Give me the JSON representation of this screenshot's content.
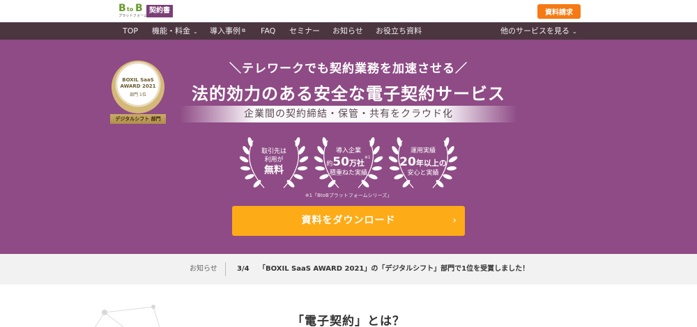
{
  "header": {
    "logo": {
      "b1": "B",
      "to": "to",
      "b2": "B",
      "sub": "プラットフォーム",
      "badge": "契約書"
    },
    "request_button": "資料請求"
  },
  "nav": {
    "items": [
      {
        "label": "TOP"
      },
      {
        "label": "機能・料金",
        "caret": "⌄"
      },
      {
        "label": "導入事例",
        "ext": "⧉"
      },
      {
        "label": "FAQ"
      },
      {
        "label": "セミナー"
      },
      {
        "label": "お知らせ"
      },
      {
        "label": "お役立ち資料"
      }
    ],
    "other_services": "他のサービスを見る",
    "other_caret": "⌄"
  },
  "hero": {
    "award": {
      "line1": "BOXIL SaaS",
      "line2": "AWARD 2021",
      "line3": "部門 1位",
      "ribbon": "デジタルシフト 部門"
    },
    "tagline": "＼テレワークでも契約業務を加速させる／",
    "title": "法的効力のある安全な電子契約サービス",
    "subtitle": "企業間の契約締結・保管・共有をクラウド化",
    "badges": [
      {
        "top": "取引先は",
        "mid": "利用が",
        "big": "無料"
      },
      {
        "top": "導入企業",
        "prefix": "約",
        "num": "50",
        "unit": "万社",
        "note": "※1",
        "bottom": "積重ねた実績"
      },
      {
        "top": "運用実績",
        "num": "20",
        "unit": "年以上の",
        "bottom": "安心と実績"
      }
    ],
    "footnote": "※1「BtoBプラットフォームシリーズ」",
    "download_label": "資料をダウンロード",
    "download_chevron": "›"
  },
  "news": {
    "label": "お知らせ",
    "date": "3/4",
    "text": "「BOXIL SaaS AWARD 2021」の「デジタルシフト」部門で1位を受賞しました！"
  },
  "section": {
    "title": "「電子契約」とは？"
  },
  "colors": {
    "brand_purple": "#8e4b85",
    "nav_bg": "#4b3640",
    "accent_orange": "#f57a14",
    "cta_yellow": "#fdab17"
  }
}
